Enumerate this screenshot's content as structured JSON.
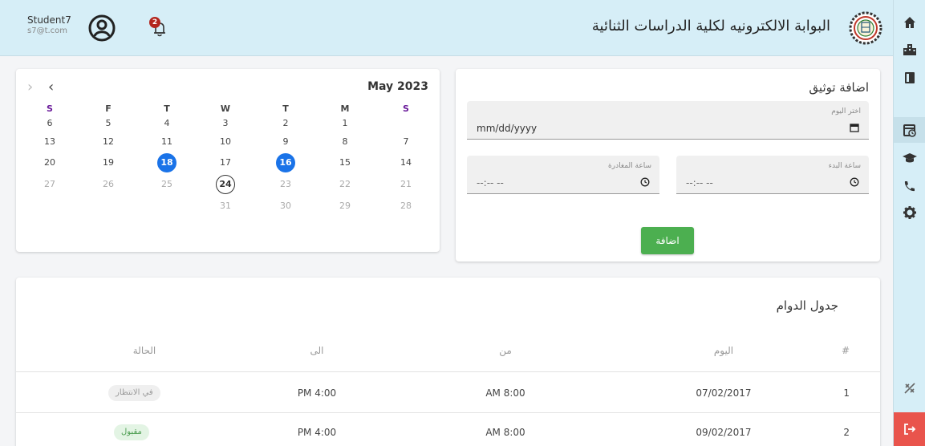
{
  "header": {
    "title": "البوابة الالكترونيه لكلية الدراسات الثنائية",
    "user_name": "Student7",
    "user_email": "s7@t.com",
    "notification_count": "2"
  },
  "calendar": {
    "month_label": "May 2023",
    "weekdays": [
      "S",
      "F",
      "T",
      "W",
      "T",
      "M",
      "S"
    ],
    "rows": [
      [
        "6",
        "5",
        "4",
        "3",
        "2",
        "1",
        ""
      ],
      [
        "13",
        "12",
        "11",
        "10",
        "9",
        "8",
        "7"
      ],
      [
        "20",
        "19",
        "18",
        "17",
        "16",
        "15",
        "14"
      ],
      [
        "27",
        "26",
        "25",
        "24",
        "23",
        "22",
        "21"
      ],
      [
        "",
        "",
        "",
        "31",
        "30",
        "29",
        "28"
      ]
    ],
    "highlighted_days": [
      "18",
      "16"
    ],
    "today": "24"
  },
  "form": {
    "title": "اضافة توثيق",
    "date_label": "اختر اليوم",
    "date_placeholder": "mm/dd/yyyy",
    "start_label": "ساعة البدء",
    "end_label": "ساعة المغادرة",
    "time_placeholder": "--:-- --",
    "submit_label": "اضافة"
  },
  "schedule": {
    "title": "جدول الدوام",
    "columns": [
      "#",
      "اليوم",
      "من",
      "الى",
      "الحالة"
    ],
    "rows": [
      {
        "num": "1",
        "day": "07/02/2017",
        "from": "AM 8:00",
        "to": "PM 4:00",
        "status": "في الانتظار",
        "status_type": "pending"
      },
      {
        "num": "2",
        "day": "09/02/2017",
        "from": "AM 8:00",
        "to": "PM 4:00",
        "status": "مقبول",
        "status_type": "ok"
      }
    ]
  },
  "colors": {
    "header_bg": "#d6eef7",
    "accent_blue": "#1a73e8",
    "success_green": "#4caf50",
    "logout_red": "#e9544c"
  },
  "sidebar_icons": [
    "home-icon",
    "building-icon",
    "book-icon",
    "calendar-clock-icon",
    "graduation-cap-icon",
    "phone-icon",
    "gear-icon",
    "collapse-icon",
    "logout-icon"
  ]
}
